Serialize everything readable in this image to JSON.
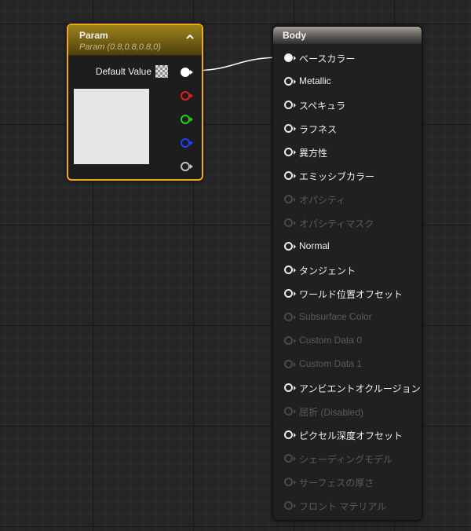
{
  "param_node": {
    "title": "Param",
    "subtitle": "Param (0.8,0.8,0.8,0)",
    "default_value_label": "Default Value",
    "preview_color": "#e6e6e6",
    "header_color": "#8a7316",
    "border_color": "#f0a81c",
    "output_pins": [
      {
        "name": "rgba",
        "color": "#ffffff"
      },
      {
        "name": "r",
        "color": "#e02020"
      },
      {
        "name": "g",
        "color": "#20d020"
      },
      {
        "name": "b",
        "color": "#2040ff"
      },
      {
        "name": "a",
        "color": "#c0c0c0"
      }
    ]
  },
  "body_node": {
    "title": "Body",
    "pins": [
      {
        "label": "ベースカラー",
        "enabled": true,
        "connected": true
      },
      {
        "label": "Metallic",
        "enabled": true,
        "connected": false
      },
      {
        "label": "スペキュラ",
        "enabled": true,
        "connected": false
      },
      {
        "label": "ラフネス",
        "enabled": true,
        "connected": false
      },
      {
        "label": "異方性",
        "enabled": true,
        "connected": false
      },
      {
        "label": "エミッシブカラー",
        "enabled": true,
        "connected": false
      },
      {
        "label": "オパシティ",
        "enabled": false,
        "connected": false
      },
      {
        "label": "オパシティマスク",
        "enabled": false,
        "connected": false
      },
      {
        "label": "Normal",
        "enabled": true,
        "connected": false
      },
      {
        "label": "タンジェント",
        "enabled": true,
        "connected": false
      },
      {
        "label": "ワールド位置オフセット",
        "enabled": true,
        "connected": false
      },
      {
        "label": "Subsurface Color",
        "enabled": false,
        "connected": false
      },
      {
        "label": "Custom Data 0",
        "enabled": false,
        "connected": false
      },
      {
        "label": "Custom Data 1",
        "enabled": false,
        "connected": false
      },
      {
        "label": "アンビエントオクルージョン",
        "enabled": true,
        "connected": false
      },
      {
        "label": "屈折 (Disabled)",
        "enabled": false,
        "connected": false
      },
      {
        "label": "ピクセル深度オフセット",
        "enabled": true,
        "connected": false
      },
      {
        "label": "シェーディングモデル",
        "enabled": false,
        "connected": false
      },
      {
        "label": "サーフェスの厚さ",
        "enabled": false,
        "connected": false
      },
      {
        "label": "フロント マテリアル",
        "enabled": false,
        "connected": false
      }
    ]
  },
  "icons": {
    "collapse": "chevron-up-icon",
    "color_swatch": "checkerboard-swatch-icon"
  }
}
